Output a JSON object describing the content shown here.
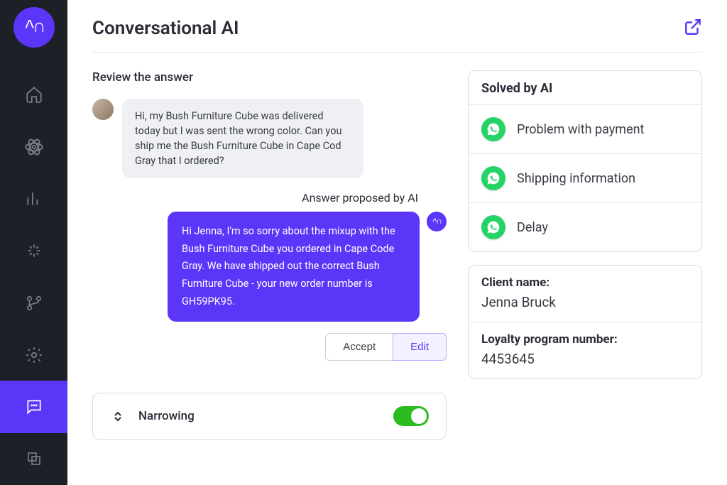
{
  "header": {
    "title": "Conversational AI"
  },
  "review": {
    "title": "Review the answer",
    "user_message": "Hi, my Bush Furniture Cube was delivered today but I was sent the wrong color. Can you ship me the Bush Furniture Cube in Cape Cod Gray that I ordered?",
    "ai_label": "Answer proposed by AI",
    "ai_message": "Hi Jenna, I'm so sorry about the mixup with the Bush Furniture Cube you ordered in Cape Code Gray. We have shipped out the correct Bush Furniture Cube - your new order number is GH59PK95.",
    "accept_label": "Accept",
    "edit_label": "Edit"
  },
  "narrowing": {
    "label": "Narrowing",
    "enabled": true
  },
  "solved": {
    "title": "Solved by AI",
    "items": [
      {
        "label": "Problem with payment"
      },
      {
        "label": "Shipping information"
      },
      {
        "label": "Delay"
      }
    ]
  },
  "client": {
    "name_label": "Client name:",
    "name_value": "Jenna Bruck",
    "loyalty_label": "Loyalty program number:",
    "loyalty_value": "4453645"
  }
}
